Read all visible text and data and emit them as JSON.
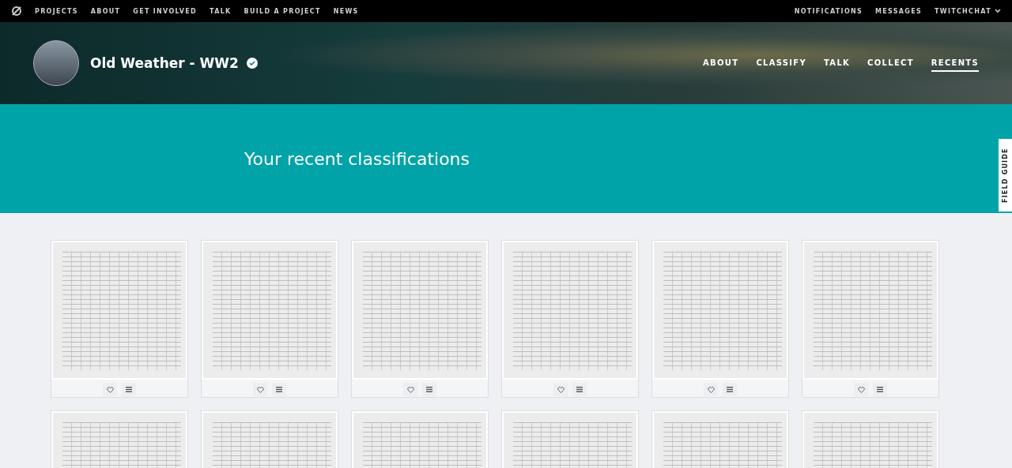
{
  "top_nav": {
    "links": [
      "PROJECTS",
      "ABOUT",
      "GET INVOLVED",
      "TALK",
      "BUILD A PROJECT",
      "NEWS"
    ],
    "user_links": [
      "NOTIFICATIONS",
      "MESSAGES"
    ],
    "user_menu": "TWITCHCHAT"
  },
  "project": {
    "title": "Old Weather - WW2",
    "tabs": [
      {
        "label": "ABOUT",
        "selected": false
      },
      {
        "label": "CLASSIFY",
        "selected": false
      },
      {
        "label": "TALK",
        "selected": false
      },
      {
        "label": "COLLECT",
        "selected": false
      },
      {
        "label": "RECENTS",
        "selected": true
      }
    ]
  },
  "heading": "Your recent classifications",
  "field_guide": "FIELD GUIDE",
  "classifications": [
    {
      "kind": "full",
      "favorited": false
    },
    {
      "kind": "full",
      "favorited": false
    },
    {
      "kind": "full",
      "favorited": false
    },
    {
      "kind": "full",
      "favorited": false
    },
    {
      "kind": "full",
      "favorited": false
    },
    {
      "kind": "full",
      "favorited": false
    },
    {
      "kind": "cut_off"
    },
    {
      "kind": "cut_off"
    },
    {
      "kind": "cut_off"
    },
    {
      "kind": "cut_off"
    },
    {
      "kind": "cut_off"
    },
    {
      "kind": "cut_off"
    }
  ]
}
